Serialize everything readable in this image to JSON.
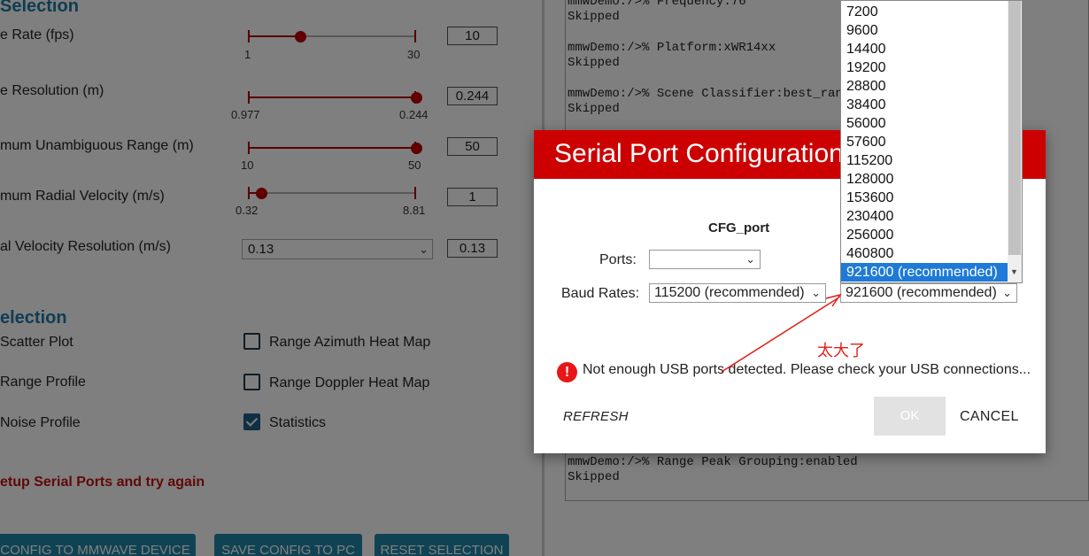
{
  "left_panel": {
    "scene_section_title": "Selection",
    "params": [
      {
        "label": "e Rate (fps)",
        "min": "1",
        "max": "30",
        "value": "10",
        "fraction": 0.31
      },
      {
        "label": "e Resolution (m)",
        "min": "0.977",
        "max": "0.244",
        "value": "0.244",
        "fraction": 1.0
      },
      {
        "label": "mum Unambiguous Range (m)",
        "min": "10",
        "max": "50",
        "value": "50",
        "fraction": 1.0
      },
      {
        "label": "mum Radial Velocity (m/s)",
        "min": "0.32",
        "max": "8.81",
        "value": "1",
        "fraction": 0.08
      }
    ],
    "velocity_resolution": {
      "label": "al Velocity Resolution (m/s)",
      "selected": "0.13",
      "value": "0.13"
    },
    "plot_section_title": "election",
    "plots": [
      {
        "label": "Scatter Plot",
        "option": "Range Azimuth Heat Map",
        "checked": false
      },
      {
        "label": "Range Profile",
        "option": "Range Doppler Heat Map",
        "checked": false
      },
      {
        "label": "Noise Profile",
        "option": "Statistics",
        "checked": true
      }
    ],
    "error_message": "etup Serial Ports and try again",
    "buttons": [
      "CONFIG TO MMWAVE DEVICE",
      "SAVE CONFIG TO PC",
      "RESET SELECTION"
    ]
  },
  "console": {
    "lines": [
      "mmwDemo:/>% Frequency:76",
      "Skipped",
      "mmwDemo:/>% Platform:xWR14xx",
      "Skipped",
      "mmwDemo:/>% Scene Classifier:best_range",
      "Skipped",
      "mmwDemo:/>% Range Peak Grouping:enabled",
      "Skipped"
    ]
  },
  "dialog": {
    "title": "Serial Port Configuration",
    "cfg_port_label": "CFG_port",
    "ports_label": "Ports:",
    "ports_value": "",
    "baud_label": "Baud Rates:",
    "baud_cfg_value": "115200 (recommended)",
    "baud_data_value": "921600 (recommended)",
    "annotation": "太大了",
    "warning": "Not enough USB ports detected. Please check your USB connections...",
    "warning_icon": "!",
    "refresh": "REFRESH",
    "ok": "OK",
    "cancel": "CANCEL"
  },
  "dropdown": {
    "options": [
      "7200",
      "9600",
      "14400",
      "19200",
      "28800",
      "38400",
      "56000",
      "57600",
      "115200",
      "128000",
      "153600",
      "230400",
      "256000",
      "460800",
      "921600 (recommended)"
    ],
    "selected_index": 14
  },
  "colors": {
    "dialog_header": "#cc0000",
    "section_title": "#1f7aa6",
    "error_text": "#c41010",
    "selection_highlight": "#1e7ad6",
    "annotation": "#e0201a",
    "primary_button": "#1f86a8"
  }
}
